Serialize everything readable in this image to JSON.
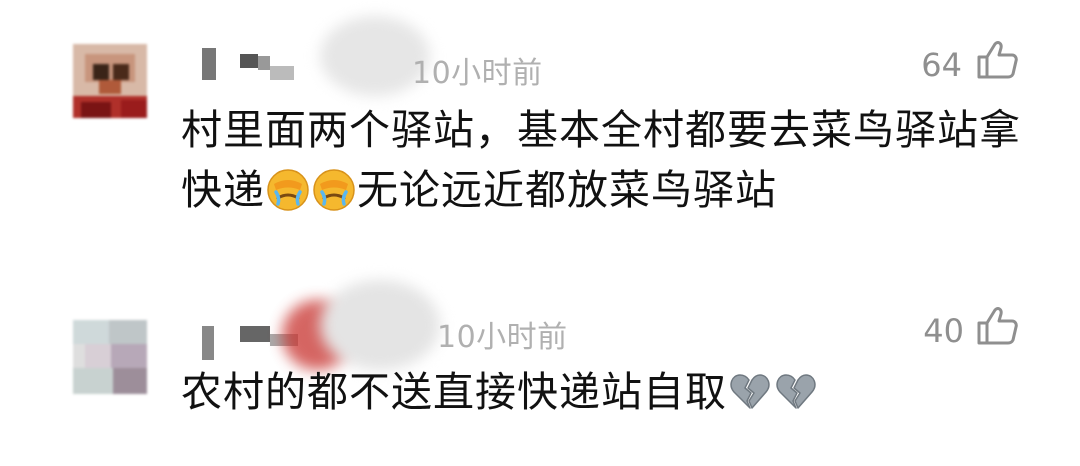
{
  "comments": [
    {
      "time": "10小时前",
      "likes": "64",
      "text_line1": "村里面两个驿站，基本全村都要去菜鸟驿站拿",
      "text_line2_a": "快递",
      "text_line2_b": "无论远近都放菜鸟驿站",
      "emojis": [
        "facepalm-crying-emoji",
        "facepalm-crying-emoji"
      ]
    },
    {
      "time": "10小时前",
      "likes": "40",
      "text": "农村的都不送直接快递站自取",
      "emojis": [
        "broken-heart-emoji",
        "broken-heart-emoji"
      ]
    }
  ],
  "icons": {
    "like": "thumbs-up-outline-icon"
  },
  "colors": {
    "text": "#111111",
    "time": "#b0b0b0",
    "likes": "#8f8f8f",
    "background": "#ffffff"
  }
}
